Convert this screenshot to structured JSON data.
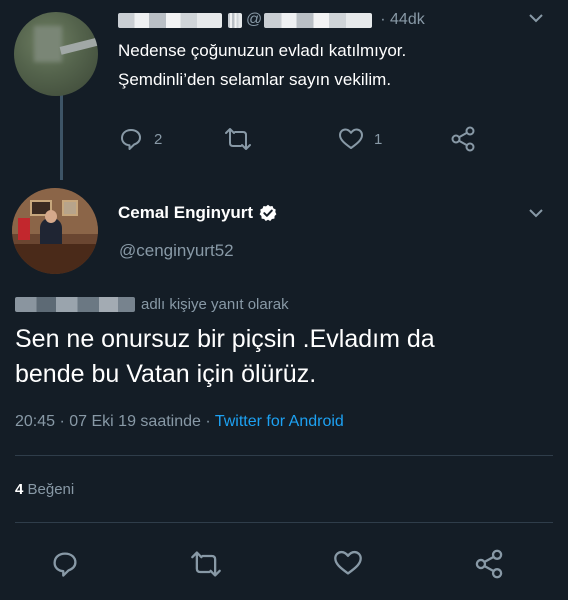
{
  "parent_tweet": {
    "handle_prefix": "@",
    "time": "· 44dk",
    "lines": [
      "Nedense çoğunuzun evladı katılmıyor.",
      "Şemdinli’den selamlar sayın vekilim."
    ],
    "actions": {
      "reply_count": "2",
      "like_count": "1",
      "reply_icon": "reply-icon",
      "retweet_icon": "retweet-icon",
      "like_icon": "heart-icon",
      "share_icon": "share-icon"
    }
  },
  "main_tweet": {
    "display_name": "Cemal Enginyurt",
    "verified_icon": "verified-badge-icon",
    "handle": "@cenginyurt52",
    "reply_to_suffix": "adlı kişiye yanıt olarak",
    "text_lines": [
      "Sen ne onursuz bir piçsin .Evladım da",
      "bende bu Vatan için ölürüz."
    ],
    "timestamp": "20:45 · 07 Eki 19 saatinde ·",
    "source": "Twitter for Android",
    "likes_count": "4",
    "likes_label": "Beğeni"
  },
  "colors": {
    "background": "#141d26",
    "secondary_text": "#8899a6",
    "accent": "#1da1f2",
    "divider": "#2f3d4a"
  }
}
